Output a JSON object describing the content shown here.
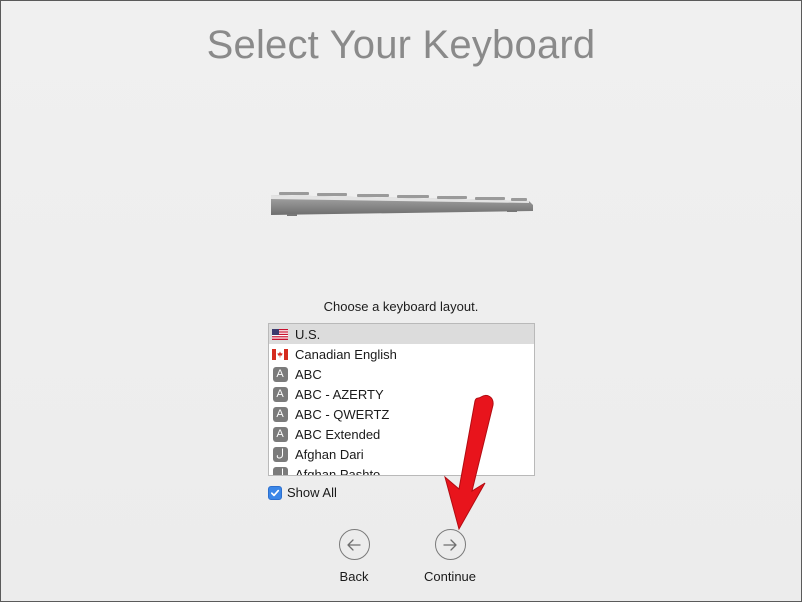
{
  "title": "Select Your Keyboard",
  "prompt": "Choose a keyboard layout.",
  "layouts": [
    {
      "label": "U.S.",
      "icon": "us-flag-icon",
      "selected": true
    },
    {
      "label": "Canadian English",
      "icon": "canada-flag-icon",
      "selected": false
    },
    {
      "label": "ABC",
      "icon": "letter-a-icon",
      "selected": false
    },
    {
      "label": "ABC - AZERTY",
      "icon": "letter-a-icon",
      "selected": false
    },
    {
      "label": "ABC - QWERTZ",
      "icon": "letter-a-icon",
      "selected": false
    },
    {
      "label": "ABC Extended",
      "icon": "letter-a-icon",
      "selected": false
    },
    {
      "label": "Afghan Dari",
      "icon": "arabic-letter-icon",
      "selected": false
    },
    {
      "label": "Afghan Pashto",
      "icon": "arabic-letter-icon",
      "selected": false
    }
  ],
  "glyphs": {
    "latin": "A",
    "arabic": "ل"
  },
  "show_all": {
    "label": "Show All",
    "checked": true
  },
  "nav": {
    "back_label": "Back",
    "continue_label": "Continue"
  },
  "colors": {
    "accent": "#3a86e8",
    "annotation_arrow": "#e8141c",
    "title": "#8a8a8a"
  }
}
